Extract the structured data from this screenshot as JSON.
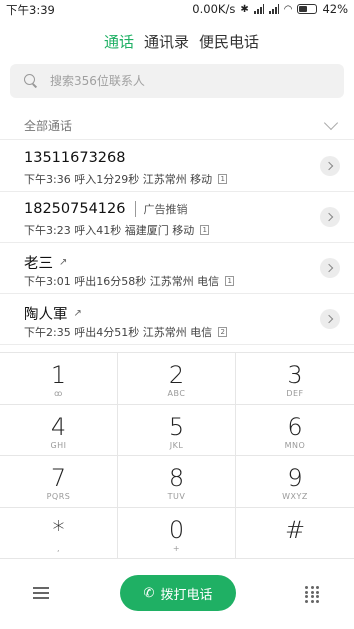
{
  "status_bar": {
    "time": "下午3:39",
    "network_speed": "0.00K/s",
    "battery": "42%",
    "icons": [
      "bluetooth-icon",
      "signal-icon",
      "signal-icon",
      "wifi-icon",
      "battery-icon"
    ]
  },
  "tabs": [
    {
      "label": "通话",
      "active": true
    },
    {
      "label": "通讯录",
      "active": false
    },
    {
      "label": "便民电话",
      "active": false
    }
  ],
  "search": {
    "placeholder": "搜索356位联系人"
  },
  "filter": {
    "label": "全部通话"
  },
  "calls": [
    {
      "name": "13511673268",
      "tag": "",
      "detail": "下午3:36 呼入1分29秒  江苏常州 移动",
      "sim": "1"
    },
    {
      "name": "18250754126",
      "tag": "广告推销",
      "detail": "下午3:23 呼入41秒  福建厦门 移动",
      "sim": "1"
    },
    {
      "name": "老三",
      "tag": "",
      "outgoing": true,
      "detail": "下午3:01 呼出16分58秒  江苏常州 电信",
      "sim": "1"
    },
    {
      "name": "陶人軍",
      "tag": "",
      "outgoing": true,
      "detail": "下午2:35 呼出4分51秒  江苏常州 电信",
      "sim": "2"
    }
  ],
  "keypad": [
    {
      "digit": "1",
      "sub": "ꝏ"
    },
    {
      "digit": "2",
      "sub": "ABC"
    },
    {
      "digit": "3",
      "sub": "DEF"
    },
    {
      "digit": "4",
      "sub": "GHI"
    },
    {
      "digit": "5",
      "sub": "JKL"
    },
    {
      "digit": "6",
      "sub": "MNO"
    },
    {
      "digit": "7",
      "sub": "PQRS"
    },
    {
      "digit": "8",
      "sub": "TUV"
    },
    {
      "digit": "9",
      "sub": "WXYZ"
    },
    {
      "digit": "*",
      "sub": ","
    },
    {
      "digit": "0",
      "sub": "+"
    },
    {
      "digit": "#",
      "sub": ""
    }
  ],
  "bottom": {
    "dial_label": "拨打电话"
  },
  "colors": {
    "accent": "#1fb064"
  }
}
